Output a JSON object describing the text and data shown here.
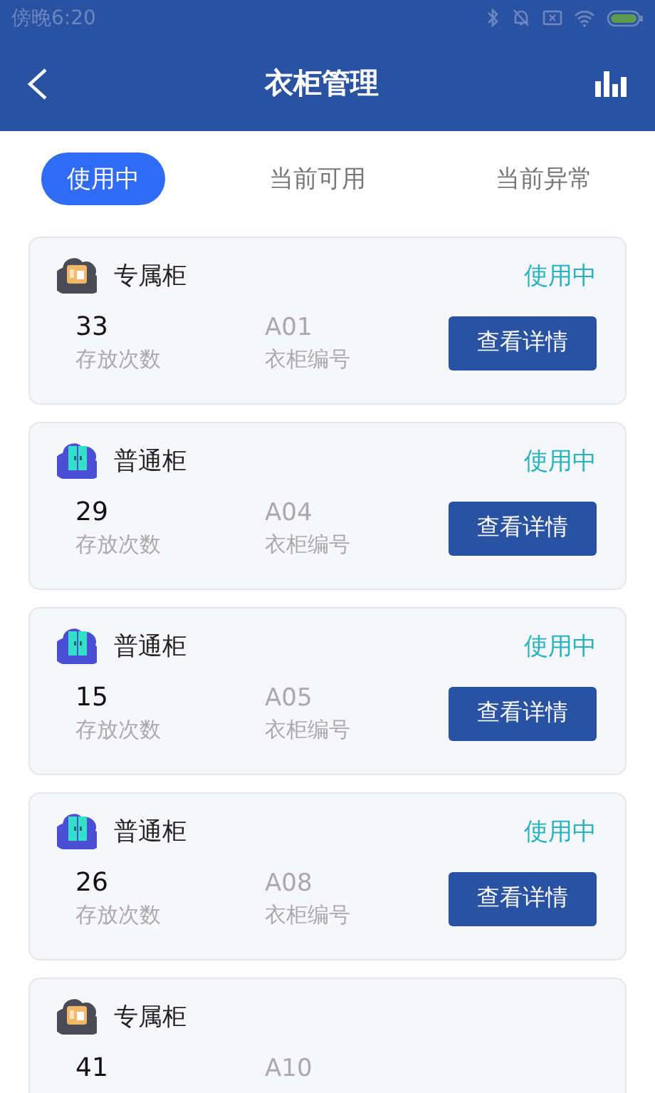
{
  "status_bar": {
    "time": "傍晚6:20"
  },
  "header": {
    "title": "衣柜管理"
  },
  "tabs": [
    {
      "label": "使用中",
      "selected": true
    },
    {
      "label": "当前可用",
      "selected": false
    },
    {
      "label": "当前异常",
      "selected": false
    }
  ],
  "cards": [
    {
      "kind": "exclusive",
      "name": "专属柜",
      "status": "使用中",
      "count": "33",
      "count_label": "存放次数",
      "code": "A01",
      "code_label": "衣柜编号",
      "button": "查看详情"
    },
    {
      "kind": "regular",
      "name": "普通柜",
      "status": "使用中",
      "count": "29",
      "count_label": "存放次数",
      "code": "A04",
      "code_label": "衣柜编号",
      "button": "查看详情"
    },
    {
      "kind": "regular",
      "name": "普通柜",
      "status": "使用中",
      "count": "15",
      "count_label": "存放次数",
      "code": "A05",
      "code_label": "衣柜编号",
      "button": "查看详情"
    },
    {
      "kind": "regular",
      "name": "普通柜",
      "status": "使用中",
      "count": "26",
      "count_label": "存放次数",
      "code": "A08",
      "code_label": "衣柜编号",
      "button": "查看详情"
    },
    {
      "kind": "exclusive",
      "name": "专属柜",
      "count": "41",
      "code": "A10"
    }
  ]
}
